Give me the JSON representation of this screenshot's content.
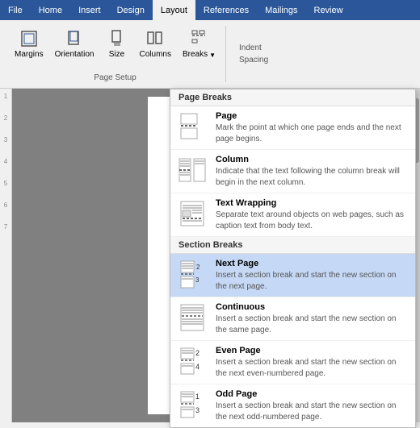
{
  "ribbon": {
    "tabs": [
      "File",
      "Home",
      "Insert",
      "Design",
      "Layout",
      "References",
      "Mailings",
      "Review"
    ],
    "active_tab": "Layout",
    "reference_tab": "References",
    "toolbar": {
      "groups": [
        {
          "label": "Page Setup",
          "buttons": [
            "Margins",
            "Orientation",
            "Size",
            "Columns"
          ]
        }
      ],
      "breaks_label": "Breaks",
      "indent_label": "Indent",
      "spacing_label": "Spacing"
    }
  },
  "dropdown": {
    "page_breaks_header": "Page Breaks",
    "section_breaks_header": "Section Breaks",
    "items": [
      {
        "id": "page",
        "title": "Page",
        "description": "Mark the point at which one page ends and the next page begins.",
        "highlighted": false
      },
      {
        "id": "column",
        "title": "Column",
        "description": "Indicate that the text following the column break will begin in the next column.",
        "highlighted": false
      },
      {
        "id": "text-wrapping",
        "title": "Text Wrapping",
        "description": "Separate text around objects on web pages, such as caption text from body text.",
        "highlighted": false
      },
      {
        "id": "next-page",
        "title": "Next Page",
        "description": "Insert a section break and start the new section on the next page.",
        "highlighted": true
      },
      {
        "id": "continuous",
        "title": "Continuous",
        "description": "Insert a section break and start the new section on the same page.",
        "highlighted": false
      },
      {
        "id": "even-page",
        "title": "Even Page",
        "description": "Insert a section break and start the new section on the next even-numbered page.",
        "highlighted": false
      },
      {
        "id": "odd-page",
        "title": "Odd Page",
        "description": "Insert a section break and start the new section on the next odd-numbered page.",
        "highlighted": false
      }
    ]
  },
  "ruler": {
    "numbers": [
      "1",
      "2",
      "3",
      "4",
      "5",
      "6",
      "7"
    ]
  }
}
